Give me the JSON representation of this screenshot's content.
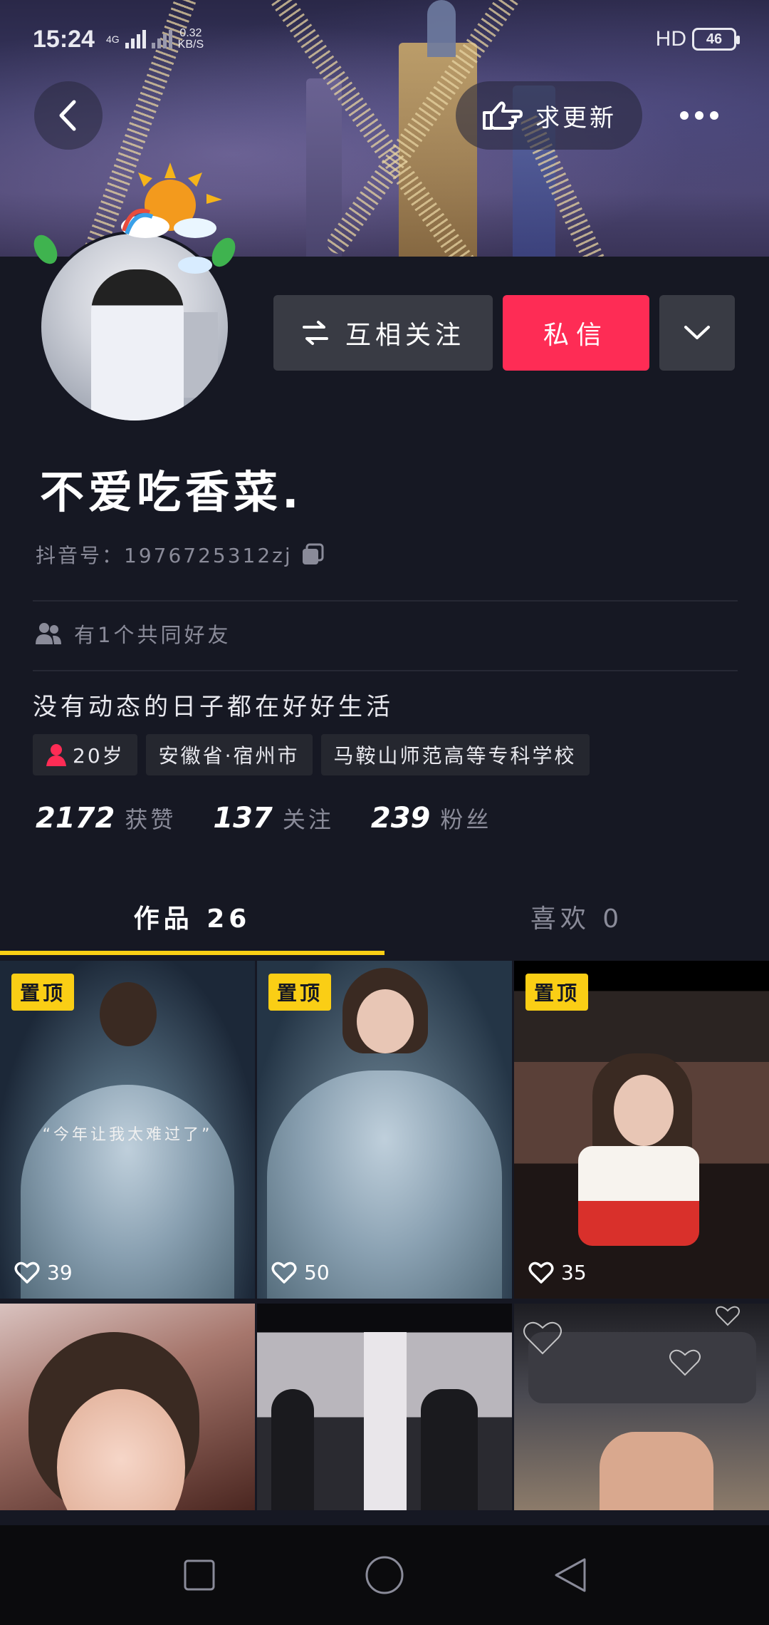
{
  "status_bar": {
    "time": "15:24",
    "net_type": "4G",
    "speed_value": "0.32",
    "speed_unit": "KB/S",
    "hd_label": "HD",
    "battery": "46"
  },
  "header": {
    "back_icon": "chevron-left-icon",
    "update_label": "求更新",
    "update_icon": "pointing-hand-icon",
    "more_icon": "more-dots-icon"
  },
  "profile": {
    "follow_label": "互相关注",
    "message_label": "私信",
    "nickname": "不爱吃香菜.",
    "douyin_id": "抖音号：1976725312zj",
    "mutual_friends": "有1个共同好友",
    "bio": "没有动态的日子都在好好生活",
    "tags": {
      "age": "20岁",
      "location": "安徽省·宿州市",
      "school": "马鞍山师范高等专科学校"
    },
    "stats": {
      "likes_num": "2172",
      "likes_label": "获赞",
      "following_num": "137",
      "following_label": "关注",
      "followers_num": "239",
      "followers_label": "粉丝"
    }
  },
  "tabs": {
    "works": "作品 26",
    "liked": "喜欢 0"
  },
  "videos": [
    {
      "pinned": "置顶",
      "likes": "39",
      "caption": "“今年让我太难过了”"
    },
    {
      "pinned": "置顶",
      "likes": "50"
    },
    {
      "pinned": "置顶",
      "likes": "35"
    },
    {},
    {},
    {}
  ],
  "colors": {
    "background": "#161823",
    "accent_red": "#fe2c55",
    "accent_yellow": "#face15",
    "secondary_text": "#8a8b99"
  }
}
